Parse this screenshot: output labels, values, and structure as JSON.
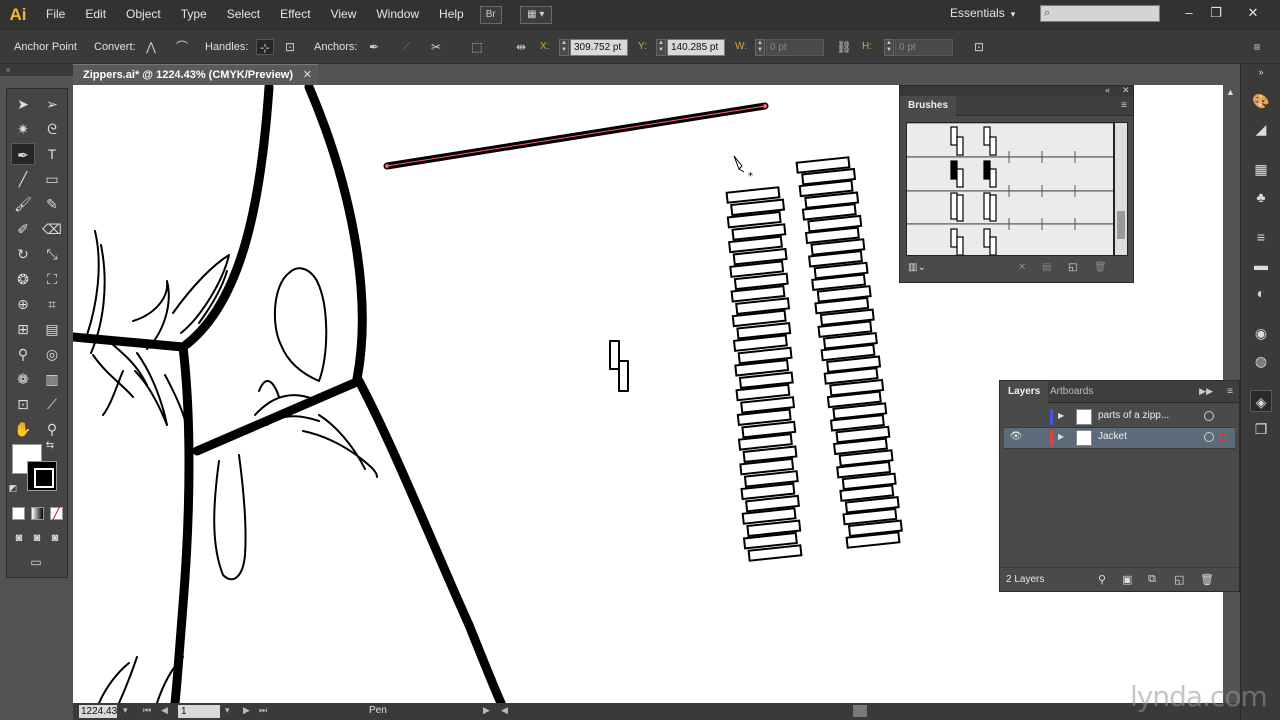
{
  "app": {
    "logo": "Ai"
  },
  "menu": [
    "File",
    "Edit",
    "Object",
    "Type",
    "Select",
    "Effect",
    "View",
    "Window",
    "Help"
  ],
  "menubar": {
    "bridge_label": "Br",
    "arrange_label": "▦ ▾",
    "workspace": "Essentials",
    "search_placeholder": ""
  },
  "controlbar": {
    "anchor_point": "Anchor Point",
    "convert": "Convert:",
    "handles": "Handles:",
    "anchors": "Anchors:",
    "x_label": "X:",
    "x_value": "309.752 pt",
    "y_label": "Y:",
    "y_value": "140.285 pt",
    "w_label": "W:",
    "w_value": "0 pt",
    "h_label": "H:",
    "h_value": "0 pt"
  },
  "document": {
    "tab_title": "Zippers.ai* @ 1224.43% (CMYK/Preview)"
  },
  "status": {
    "zoom": "1224.43",
    "page": "1",
    "tool": "Pen"
  },
  "brushes": {
    "title": "Brushes"
  },
  "layers": {
    "tabs": [
      "Layers",
      "Artboards"
    ],
    "rows": [
      {
        "name": "parts of a zipp...",
        "color": "#4b52d6",
        "visible": false
      },
      {
        "name": "Jacket",
        "color": "#e04040",
        "visible": true
      }
    ],
    "count": "2 Layers"
  },
  "watermark": "lynda.com",
  "colors": {
    "path_highlight": "#ff5a6e",
    "accent_logo": "#f7b52c",
    "selected_layer": "#5d6a7a"
  }
}
